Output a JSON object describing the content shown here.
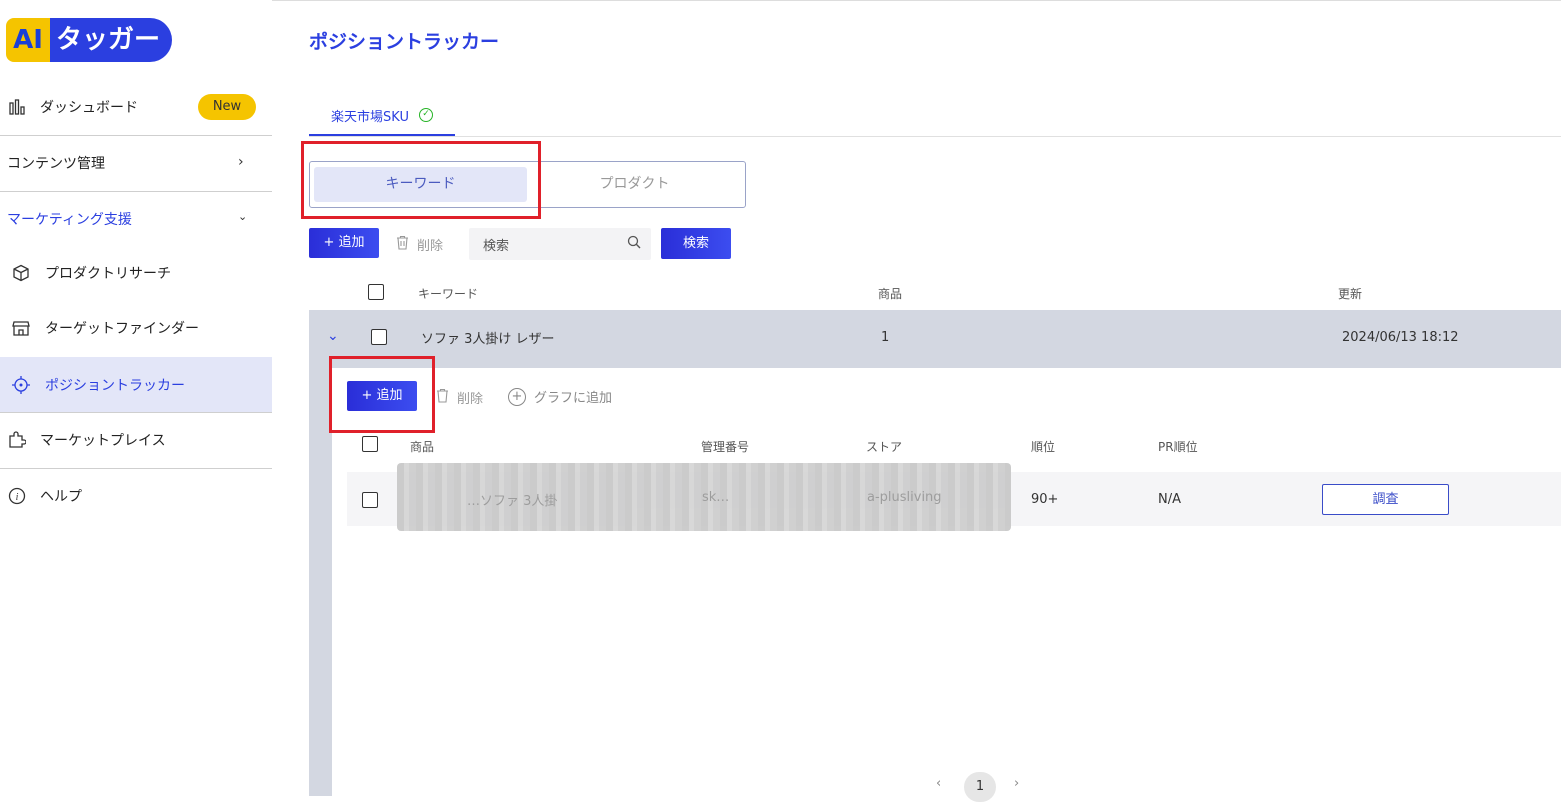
{
  "logo": {
    "ai": "AI",
    "name": "タッガー"
  },
  "sidebar": {
    "dashboard": "ダッシュボード",
    "new_badge": "New",
    "content": "コンテンツ管理",
    "marketing": "マーケティング支援",
    "product_research": "プロダクトリサーチ",
    "target_finder": "ターゲットファインダー",
    "position_tracker": "ポジショントラッカー",
    "marketplace": "マーケットプレイス",
    "help": "ヘルプ"
  },
  "page": {
    "title": "ポジショントラッカー",
    "tab": "楽天市場SKU"
  },
  "segment": {
    "keyword": "キーワード",
    "product": "プロダクト"
  },
  "toolbar": {
    "add": "+ 追加",
    "delete": "削除",
    "search_placeholder": "検索",
    "search_button": "検索"
  },
  "table": {
    "headers": {
      "keyword": "キーワード",
      "product": "商品",
      "updated": "更新"
    },
    "row": {
      "keyword": "ソファ 3人掛け レザー",
      "count": "1",
      "updated": "2024/06/13 18:12"
    }
  },
  "subtable": {
    "add": "+ 追加",
    "delete": "削除",
    "add_graph": "グラフに追加",
    "headers": {
      "product": "商品",
      "mgmt": "管理番号",
      "store": "ストア",
      "rank": "順位",
      "pr_rank": "PR順位"
    },
    "row": {
      "product": "…ソファ 3人掛",
      "mgmt": "sk…",
      "store": "a-plusliving",
      "rank": "90+",
      "pr_rank": "N/A",
      "action": "調査"
    }
  },
  "pager": {
    "prev": "‹",
    "page": "1",
    "next": "›"
  },
  "colors": {
    "accent": "#2b3fe0",
    "highlight": "#e0202a",
    "badge": "#f5c400"
  }
}
